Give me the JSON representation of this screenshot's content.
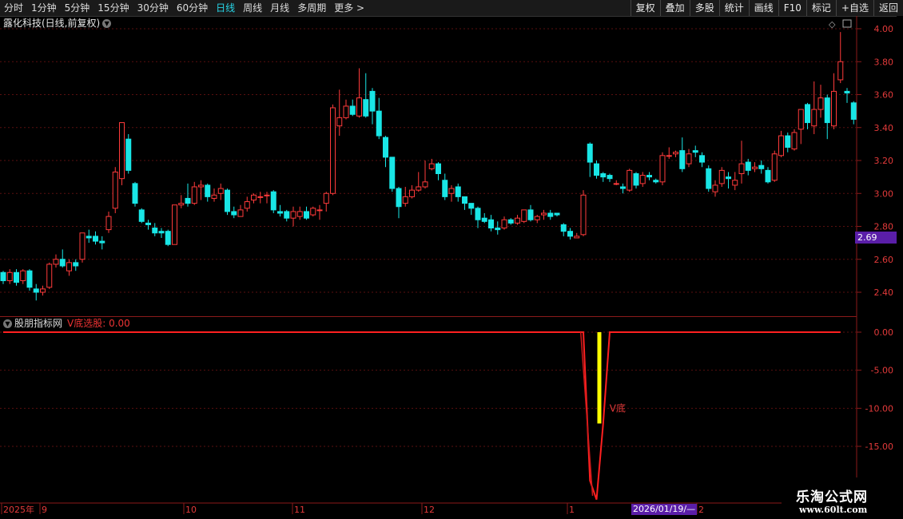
{
  "toolbar": {
    "periods": [
      "分时",
      "1分钟",
      "5分钟",
      "15分钟",
      "30分钟",
      "60分钟",
      "日线",
      "周线",
      "月线",
      "多周期",
      "更多 >"
    ],
    "active_period": "日线",
    "right_buttons": [
      "复权",
      "叠加",
      "多股",
      "统计",
      "画线",
      "F10",
      "标记",
      "+自选",
      "返回"
    ]
  },
  "stock": {
    "title": "露化科技(日线,前复权)"
  },
  "indicator": {
    "name": "股朋指标网",
    "value_text": "V底选股: 0.00",
    "signal_label": "V底"
  },
  "price_tag": "2.69",
  "date_tag": "2026/01/19/—",
  "logo": {
    "line1": "乐淘公式网",
    "line2": "www.60lt.com"
  },
  "colors": {
    "up": "#ff3b3b",
    "down": "#19e6e6",
    "axis": "#8b1a1a",
    "grid": "#5a0f0f",
    "label": "#e33a3a",
    "signal": "#ffff00"
  },
  "chart_data": [
    {
      "type": "candlestick",
      "ylim": [
        2.3,
        4.06
      ],
      "yticks": [
        "4.00",
        "3.80",
        "3.60",
        "3.40",
        "3.20",
        "3.00",
        "2.80",
        "2.60",
        "2.40"
      ],
      "xlabels": [
        "2025年",
        "9",
        "10",
        "11",
        "12",
        "1",
        "2"
      ],
      "candles": [
        [
          2.52,
          2.47,
          2.53,
          2.45
        ],
        [
          2.47,
          2.52,
          2.54,
          2.45
        ],
        [
          2.52,
          2.46,
          2.54,
          2.44
        ],
        [
          2.47,
          2.53,
          2.54,
          2.45
        ],
        [
          2.53,
          2.43,
          2.54,
          2.41
        ],
        [
          2.42,
          2.4,
          2.45,
          2.35
        ],
        [
          2.4,
          2.42,
          2.44,
          2.38
        ],
        [
          2.43,
          2.57,
          2.58,
          2.42
        ],
        [
          2.57,
          2.6,
          2.63,
          2.55
        ],
        [
          2.6,
          2.56,
          2.66,
          2.55
        ],
        [
          2.53,
          2.58,
          2.6,
          2.5
        ],
        [
          2.58,
          2.56,
          2.6,
          2.53
        ],
        [
          2.6,
          2.76,
          2.76,
          2.58
        ],
        [
          2.74,
          2.73,
          2.78,
          2.7
        ],
        [
          2.74,
          2.71,
          2.77,
          2.69
        ],
        [
          2.71,
          2.7,
          2.74,
          2.66
        ],
        [
          2.78,
          2.86,
          2.89,
          2.76
        ],
        [
          2.91,
          3.13,
          3.16,
          2.88
        ],
        [
          3.09,
          3.43,
          3.43,
          3.05
        ],
        [
          3.33,
          3.14,
          3.36,
          3.12
        ],
        [
          3.06,
          2.94,
          3.07,
          2.92
        ],
        [
          2.9,
          2.83,
          2.91,
          2.82
        ],
        [
          2.82,
          2.81,
          2.84,
          2.78
        ],
        [
          2.79,
          2.76,
          2.82,
          2.74
        ],
        [
          2.77,
          2.76,
          2.79,
          2.73
        ],
        [
          2.77,
          2.69,
          2.78,
          2.68
        ],
        [
          2.69,
          2.93,
          2.93,
          2.69
        ],
        [
          2.93,
          2.94,
          2.99,
          2.91
        ],
        [
          2.97,
          2.94,
          3.06,
          2.92
        ],
        [
          2.94,
          3.04,
          3.07,
          2.93
        ],
        [
          3.04,
          3.05,
          3.08,
          2.96
        ],
        [
          3.05,
          2.98,
          3.06,
          2.95
        ],
        [
          2.97,
          2.99,
          3.03,
          2.95
        ],
        [
          3.0,
          3.03,
          3.06,
          2.96
        ],
        [
          3.02,
          2.89,
          3.03,
          2.87
        ],
        [
          2.89,
          2.87,
          2.92,
          2.85
        ],
        [
          2.86,
          2.9,
          2.93,
          2.86
        ],
        [
          2.91,
          2.95,
          2.98,
          2.89
        ],
        [
          2.96,
          2.99,
          3.0,
          2.94
        ],
        [
          2.98,
          2.98,
          3.01,
          2.94
        ],
        [
          2.99,
          2.99,
          3.01,
          2.94
        ],
        [
          3.01,
          2.9,
          3.02,
          2.88
        ],
        [
          2.89,
          2.88,
          2.93,
          2.86
        ],
        [
          2.89,
          2.85,
          2.9,
          2.83
        ],
        [
          2.85,
          2.89,
          2.92,
          2.8
        ],
        [
          2.86,
          2.89,
          2.92,
          2.84
        ],
        [
          2.89,
          2.85,
          2.92,
          2.84
        ],
        [
          2.87,
          2.91,
          2.92,
          2.86
        ],
        [
          2.9,
          2.9,
          2.93,
          2.84
        ],
        [
          2.94,
          3.0,
          3.01,
          2.89
        ],
        [
          3.0,
          3.52,
          3.54,
          2.99
        ],
        [
          3.41,
          3.46,
          3.63,
          3.35
        ],
        [
          3.46,
          3.53,
          3.57,
          3.45
        ],
        [
          3.53,
          3.48,
          3.57,
          3.47
        ],
        [
          3.47,
          3.58,
          3.76,
          3.46
        ],
        [
          3.57,
          3.47,
          3.73,
          3.46
        ],
        [
          3.62,
          3.5,
          3.64,
          3.42
        ],
        [
          3.5,
          3.35,
          3.58,
          3.33
        ],
        [
          3.34,
          3.22,
          3.35,
          3.16
        ],
        [
          3.22,
          3.03,
          3.22,
          3.01
        ],
        [
          3.03,
          2.92,
          3.04,
          2.85
        ],
        [
          2.94,
          2.98,
          3.04,
          2.92
        ],
        [
          2.98,
          3.02,
          3.05,
          2.97
        ],
        [
          3.02,
          3.04,
          3.13,
          3.01
        ],
        [
          3.04,
          3.07,
          3.2,
          3.03
        ],
        [
          3.15,
          3.18,
          3.21,
          3.14
        ],
        [
          3.18,
          3.12,
          3.19,
          3.08
        ],
        [
          3.08,
          2.98,
          3.12,
          2.96
        ],
        [
          3.0,
          3.03,
          3.05,
          2.95
        ],
        [
          3.04,
          2.98,
          3.06,
          2.95
        ],
        [
          2.98,
          2.94,
          2.98,
          2.9
        ],
        [
          2.94,
          2.91,
          2.94,
          2.87
        ],
        [
          2.91,
          2.84,
          2.92,
          2.79
        ],
        [
          2.85,
          2.83,
          2.88,
          2.82
        ],
        [
          2.84,
          2.79,
          2.87,
          2.77
        ],
        [
          2.79,
          2.78,
          2.83,
          2.75
        ],
        [
          2.79,
          2.84,
          2.86,
          2.78
        ],
        [
          2.84,
          2.82,
          2.85,
          2.81
        ],
        [
          2.82,
          2.85,
          2.87,
          2.81
        ],
        [
          2.83,
          2.9,
          2.9,
          2.82
        ],
        [
          2.9,
          2.84,
          2.93,
          2.83
        ],
        [
          2.84,
          2.86,
          2.87,
          2.82
        ],
        [
          2.87,
          2.88,
          2.9,
          2.84
        ],
        [
          2.88,
          2.86,
          2.9,
          2.84
        ],
        [
          2.88,
          2.87,
          2.88,
          2.86
        ],
        [
          2.81,
          2.77,
          2.82,
          2.74
        ],
        [
          2.77,
          2.74,
          2.79,
          2.72
        ],
        [
          2.73,
          2.74,
          2.76,
          2.73
        ],
        [
          2.75,
          2.99,
          3.02,
          2.74
        ],
        [
          3.3,
          3.19,
          3.31,
          3.1
        ],
        [
          3.18,
          3.11,
          3.2,
          3.09
        ],
        [
          3.12,
          3.1,
          3.13,
          3.07
        ],
        [
          3.11,
          3.09,
          3.12,
          3.07
        ],
        [
          3.06,
          3.06,
          3.08,
          3.05
        ],
        [
          3.04,
          3.03,
          3.06,
          3.0
        ],
        [
          3.02,
          3.14,
          3.15,
          3.01
        ],
        [
          3.12,
          3.05,
          3.13,
          3.03
        ],
        [
          3.06,
          3.11,
          3.13,
          3.04
        ],
        [
          3.11,
          3.1,
          3.13,
          3.08
        ],
        [
          3.08,
          3.07,
          3.09,
          3.06
        ],
        [
          3.07,
          3.23,
          3.25,
          3.05
        ],
        [
          3.23,
          3.23,
          3.28,
          3.21
        ],
        [
          3.24,
          3.25,
          3.26,
          3.22
        ],
        [
          3.26,
          3.15,
          3.34,
          3.13
        ],
        [
          3.18,
          3.24,
          3.27,
          3.16
        ],
        [
          3.26,
          3.25,
          3.29,
          3.22
        ],
        [
          3.23,
          3.19,
          3.25,
          3.16
        ],
        [
          3.15,
          3.03,
          3.17,
          3.01
        ],
        [
          3.01,
          3.05,
          3.08,
          2.98
        ],
        [
          3.06,
          3.14,
          3.16,
          3.04
        ],
        [
          3.1,
          3.09,
          3.13,
          3.03
        ],
        [
          3.05,
          3.08,
          3.13,
          3.02
        ],
        [
          3.12,
          3.18,
          3.32,
          3.06
        ],
        [
          3.19,
          3.14,
          3.21,
          3.11
        ],
        [
          3.15,
          3.16,
          3.19,
          3.13
        ],
        [
          3.17,
          3.15,
          3.2,
          3.12
        ],
        [
          3.14,
          3.07,
          3.16,
          3.06
        ],
        [
          3.08,
          3.24,
          3.26,
          3.07
        ],
        [
          3.23,
          3.35,
          3.38,
          3.22
        ],
        [
          3.35,
          3.28,
          3.37,
          3.25
        ],
        [
          3.27,
          3.37,
          3.39,
          3.26
        ],
        [
          3.39,
          3.51,
          3.51,
          3.3
        ],
        [
          3.54,
          3.43,
          3.55,
          3.39
        ],
        [
          3.41,
          3.51,
          3.68,
          3.36
        ],
        [
          3.51,
          3.58,
          3.66,
          3.46
        ],
        [
          3.58,
          3.43,
          3.6,
          3.33
        ],
        [
          3.41,
          3.62,
          3.73,
          3.39
        ],
        [
          3.69,
          3.8,
          3.98,
          3.67
        ],
        [
          3.62,
          3.61,
          3.64,
          3.55
        ],
        [
          3.55,
          3.45,
          3.56,
          3.42
        ]
      ]
    },
    {
      "type": "line",
      "series": [
        {
          "name": "V底选股",
          "value": 0.0
        }
      ],
      "ylim": [
        -21,
        1
      ],
      "yticks": [
        "0.00",
        "-5.00",
        "-10.00",
        "-15.00"
      ],
      "x": [
        0,
        88,
        89,
        90,
        91,
        92,
        127
      ],
      "values": [
        0,
        0,
        -19.5,
        -22,
        -12,
        0,
        0
      ],
      "bar": [
        90,
        91,
        0,
        -12
      ]
    }
  ]
}
